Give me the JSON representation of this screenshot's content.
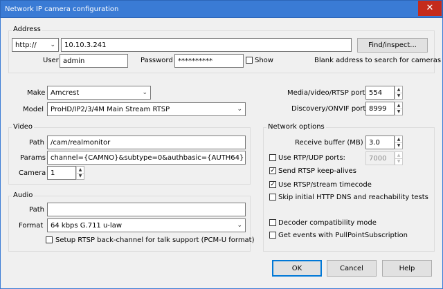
{
  "window": {
    "title": "Network IP camera configuration",
    "close_glyph": "✕"
  },
  "address": {
    "group_label": "Address",
    "protocol": "http://",
    "host": "10.10.3.241",
    "find_button": "Find/inspect...",
    "user_label": "User",
    "user_value": "admin",
    "password_label": "Password",
    "password_value": "**********",
    "show_label": "Show",
    "show_checked": false,
    "hint": "Blank address to search for cameras"
  },
  "device": {
    "make_label": "Make",
    "make_value": "Amcrest",
    "model_label": "Model",
    "model_value": "ProHD/IP2/3/4M Main Stream RTSP",
    "rtsp_port_label": "Media/video/RTSP port",
    "rtsp_port_value": "554",
    "onvif_port_label": "Discovery/ONVIF port",
    "onvif_port_value": "8999"
  },
  "video": {
    "group_label": "Video",
    "path_label": "Path",
    "path_value": "/cam/realmonitor",
    "params_label": "Params",
    "params_value": "channel={CAMNO}&subtype=0&authbasic={AUTH64}",
    "camera_label": "Camera",
    "camera_value": "1"
  },
  "audio": {
    "group_label": "Audio",
    "path_label": "Path",
    "path_value": "",
    "format_label": "Format",
    "format_value": "64 kbps G.711 u-law",
    "backchannel_label": "Setup RTSP back-channel for talk support (PCM-U format)",
    "backchannel_checked": false
  },
  "network": {
    "group_label": "Network options",
    "receive_buffer_label": "Receive buffer (MB)",
    "receive_buffer_value": "3.0",
    "rtp_udp_label": "Use RTP/UDP ports:",
    "rtp_udp_checked": false,
    "rtp_udp_value": "7000",
    "keepalive_label": "Send RTSP keep-alives",
    "keepalive_checked": true,
    "timecode_label": "Use RTSP/stream timecode",
    "timecode_checked": true,
    "skip_dns_label": "Skip initial HTTP DNS and reachability tests",
    "skip_dns_checked": false,
    "decoder_compat_label": "Decoder compatibility mode",
    "decoder_compat_checked": false,
    "pullpoint_label": "Get events with PullPointSubscription",
    "pullpoint_checked": false
  },
  "buttons": {
    "ok": "OK",
    "cancel": "Cancel",
    "help": "Help"
  },
  "glyphs": {
    "check": "✓",
    "chevron_down": "⌄",
    "spin_up": "▲",
    "spin_down": "▼"
  },
  "colors": {
    "titlebar": "#3a7bd5",
    "close": "#c42b1c",
    "default_button_border": "#0078d7"
  }
}
